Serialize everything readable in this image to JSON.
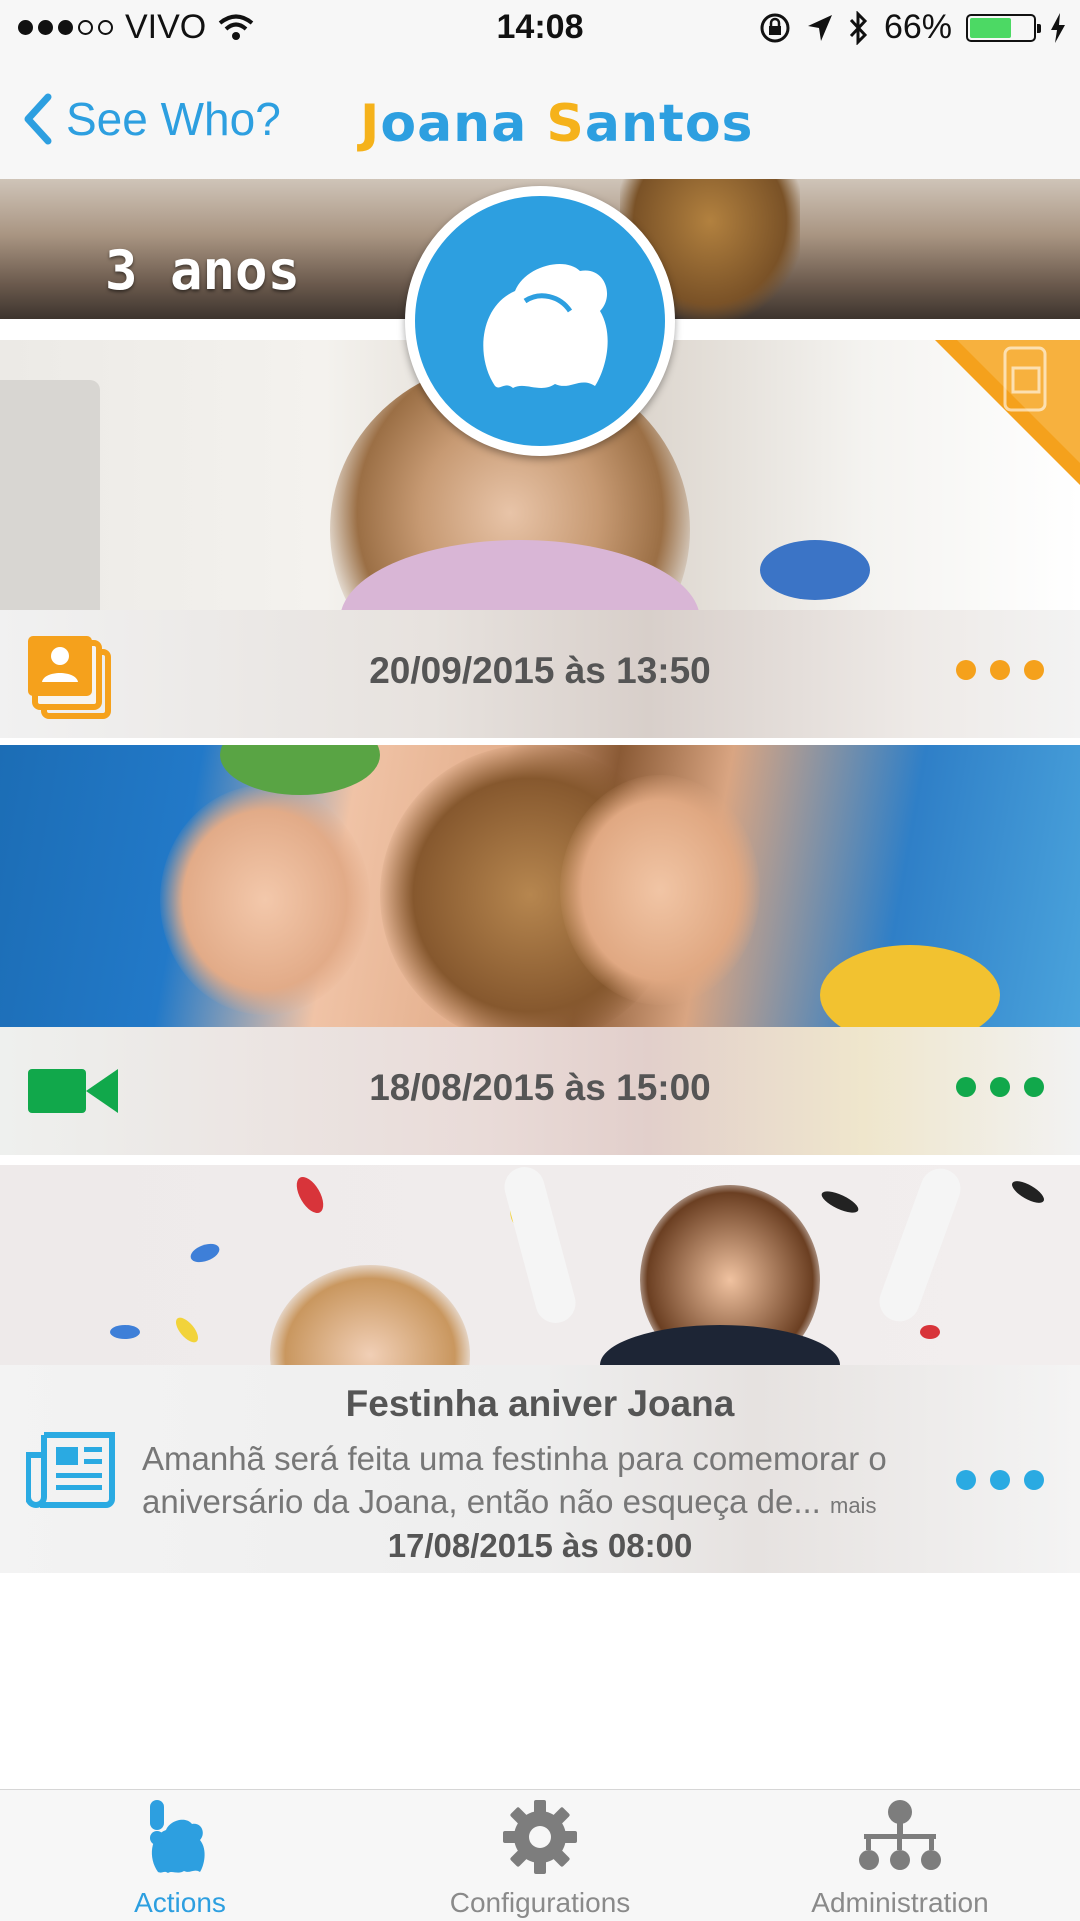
{
  "status_bar": {
    "carrier": "VIVO",
    "time": "14:08",
    "battery": "66%",
    "battery_level": 0.66
  },
  "nav": {
    "back_label": "See Who?",
    "title_first": "Joana",
    "title_last": "Santos"
  },
  "profile": {
    "age": "3 anos"
  },
  "feed": [
    {
      "type": "photo-album",
      "date": "20/09/2015 às 13:50",
      "accent": "#f5a11c"
    },
    {
      "type": "video",
      "date": "18/08/2015 às 15:00",
      "accent": "#11a84b"
    },
    {
      "type": "news",
      "title": "Festinha aniver Joana",
      "body": "Amanhã será feita uma festinha para comemorar o aniversário da Joana, então não esqueça de...",
      "more": "mais",
      "date": "17/08/2015 às 08:00",
      "accent": "#2aaae2"
    }
  ],
  "tabs": [
    {
      "label": "Actions",
      "icon": "actions-icon",
      "active": true
    },
    {
      "label": "Configurations",
      "icon": "gear-icon",
      "active": false
    },
    {
      "label": "Administration",
      "icon": "hierarchy-icon",
      "active": false
    }
  ],
  "colors": {
    "brand_blue": "#2d9fe0",
    "brand_yellow": "#f5b21b"
  }
}
